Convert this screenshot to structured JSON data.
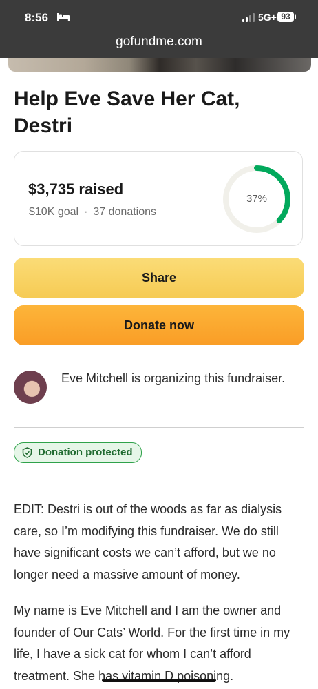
{
  "status_bar": {
    "time": "8:56",
    "network": "5G+",
    "battery": "93"
  },
  "browser": {
    "url": "gofundme.com"
  },
  "campaign": {
    "title": "Help Eve Save Her Cat, Destri",
    "raised": "$3,735 raised",
    "goal": "$10K goal",
    "separator": "·",
    "donations": "37 donations",
    "progress_label": "37%",
    "progress_fraction": 0.37,
    "progress_color": "#02a95c"
  },
  "actions": {
    "share_label": "Share",
    "donate_label": "Donate now"
  },
  "organizer": {
    "text": "Eve Mitchell is organizing this fundraiser."
  },
  "badge": {
    "label": "Donation protected",
    "icon": "shield-icon"
  },
  "description": {
    "paragraphs": [
      "EDIT: Destri is out of the woods as far as dialysis care, so I’m modifying this fundraiser. We do still have significant costs we can’t afford, but we no longer need a massive amount of money.",
      "My name is Eve Mitchell and I am the owner and founder of Our Cats’ World. For the first time in my life, I have a sick cat for whom I can’t afford treatment. She has vitamin D poisoning."
    ]
  }
}
